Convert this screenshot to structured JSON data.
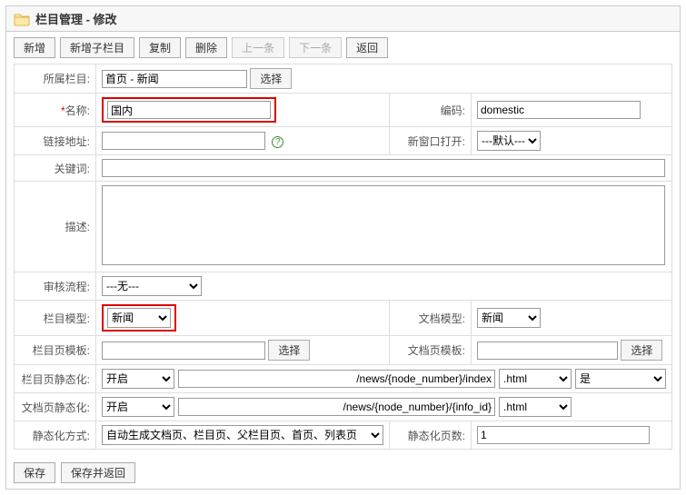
{
  "header": {
    "title": "栏目管理 - 修改"
  },
  "toolbar": {
    "new": "新增",
    "new_child": "新增子栏目",
    "copy": "复制",
    "delete": "删除",
    "prev": "上一条",
    "next": "下一条",
    "back": "返回"
  },
  "labels": {
    "parent_col": "所属栏目:",
    "name": "名称:",
    "code": "编码:",
    "link": "链接地址:",
    "new_window": "新窗口打开:",
    "keywords": "关键词:",
    "description": "描述:",
    "workflow": "审核流程:",
    "col_model": "栏目模型:",
    "doc_model": "文档模型:",
    "col_tpl": "栏目页模板:",
    "doc_tpl": "文档页模板:",
    "col_static": "栏目页静态化:",
    "doc_static": "文档页静态化:",
    "static_mode": "静态化方式:",
    "static_pages": "静态化页数:"
  },
  "buttons": {
    "select": "选择",
    "save": "保存",
    "save_back": "保存并返回"
  },
  "values": {
    "parent_col": "首页 - 新闻",
    "name": "国内",
    "code": "domestic",
    "link": "",
    "new_window": "---默认---",
    "keywords": "",
    "description": "",
    "workflow": "---无---",
    "col_model": "新闻",
    "doc_model": "新闻",
    "col_tpl": "",
    "doc_tpl": "",
    "col_static_enable": "开启",
    "col_static_path": "/news/{node_number}/index",
    "col_static_ext": ".html",
    "col_static_yes": "是",
    "doc_static_enable": "开启",
    "doc_static_path": "/news/{node_number}/{info_id}",
    "doc_static_ext": ".html",
    "static_mode": "自动生成文档页、栏目页、父栏目页、首页、列表页",
    "static_pages": "1"
  }
}
